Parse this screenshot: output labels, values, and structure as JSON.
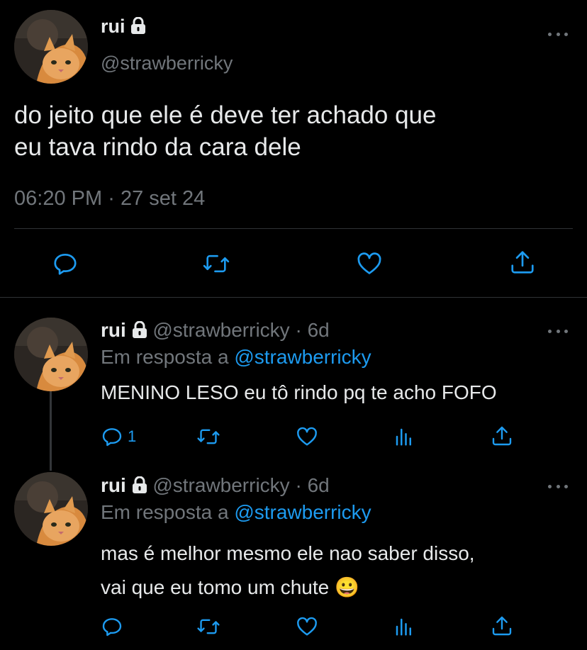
{
  "main_tweet": {
    "display_name": "rui",
    "handle": "@strawberricky",
    "text_line1": "do jeito que ele é deve ter achado que",
    "text_line2": "eu tava rindo da cara dele",
    "time": "06:20 PM",
    "separator": "·",
    "date": "27 set 24"
  },
  "replies": [
    {
      "display_name": "rui",
      "handle": "@strawberricky",
      "age": "· 6d",
      "reply_prefix": "Em resposta a",
      "reply_to": "@strawberricky",
      "text_line1": "MENINO LESO eu tô rindo pq te acho FOFO",
      "text_line2": "",
      "reply_count": "1"
    },
    {
      "display_name": "rui",
      "handle": "@strawberricky",
      "age": "· 6d",
      "reply_prefix": "Em resposta a",
      "reply_to": "@strawberricky",
      "text_line1": "mas é melhor mesmo ele nao saber disso,",
      "text_line2": "vai que eu tomo um chute",
      "emoji": "😀",
      "reply_count": ""
    }
  ],
  "icons": {
    "reply": "reply-icon",
    "retweet": "retweet-icon",
    "like": "heart-icon",
    "views": "views-icon",
    "share": "share-icon",
    "more": "more-icon",
    "lock": "lock-icon"
  },
  "colors": {
    "background": "#000000",
    "text": "#e7e9ea",
    "secondary": "#71767b",
    "link": "#1d9bf0"
  }
}
